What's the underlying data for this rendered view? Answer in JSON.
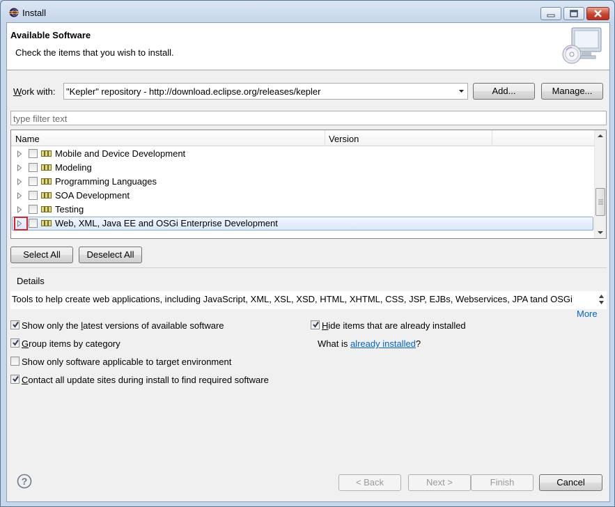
{
  "window": {
    "title": "Install"
  },
  "header": {
    "title": "Available Software",
    "subtitle": "Check the items that you wish to install."
  },
  "work_with": {
    "label_prefix": "W",
    "label_rest": "ork with:",
    "value": "\"Kepler\" repository - http://download.eclipse.org/releases/kepler",
    "add_label": "Add...",
    "manage_label": "Manage..."
  },
  "filter": {
    "placeholder": "type filter text"
  },
  "tree": {
    "columns": [
      "Name",
      "Version"
    ],
    "rows": [
      {
        "label": "Mobile and Device Development",
        "checked": false
      },
      {
        "label": "Modeling",
        "checked": false
      },
      {
        "label": "Programming Languages",
        "checked": false
      },
      {
        "label": "SOA Development",
        "checked": false
      },
      {
        "label": "Testing",
        "checked": false
      },
      {
        "label": "Web, XML, Java EE and OSGi Enterprise Development",
        "checked": false,
        "selected": true
      }
    ]
  },
  "selection_buttons": {
    "select_all": "Select All",
    "deselect_all": "Deselect All"
  },
  "details": {
    "heading": "Details",
    "text": "Tools to help create web applications, including JavaScript, XML, XSL, XSD, HTML, XHTML, CSS, JSP, EJBs, Webservices, JPA tand OSGi",
    "more": "More"
  },
  "options": {
    "latest_a": "Show only the ",
    "latest_u": "l",
    "latest_b": "atest versions of available software",
    "latest_checked": true,
    "group_u": "G",
    "group_b": "roup items by category",
    "group_checked": true,
    "target": "Show only software applicable to target environment",
    "target_checked": false,
    "contact_u": "C",
    "contact_b": "ontact all update sites during install to find required software",
    "contact_checked": true,
    "hide_u": "H",
    "hide_b": "ide items that are already installed",
    "hide_checked": true,
    "what_is": "What is ",
    "already_installed": "already installed",
    "what_is_end": "?"
  },
  "footer": {
    "back": "< Back",
    "back_u": "B",
    "next": "Next >",
    "finish": "Finish",
    "cancel": "Cancel"
  },
  "colors": {
    "link": "#0066cc",
    "selection_border": "#84acdd",
    "highlight_box": "#e0202c"
  }
}
